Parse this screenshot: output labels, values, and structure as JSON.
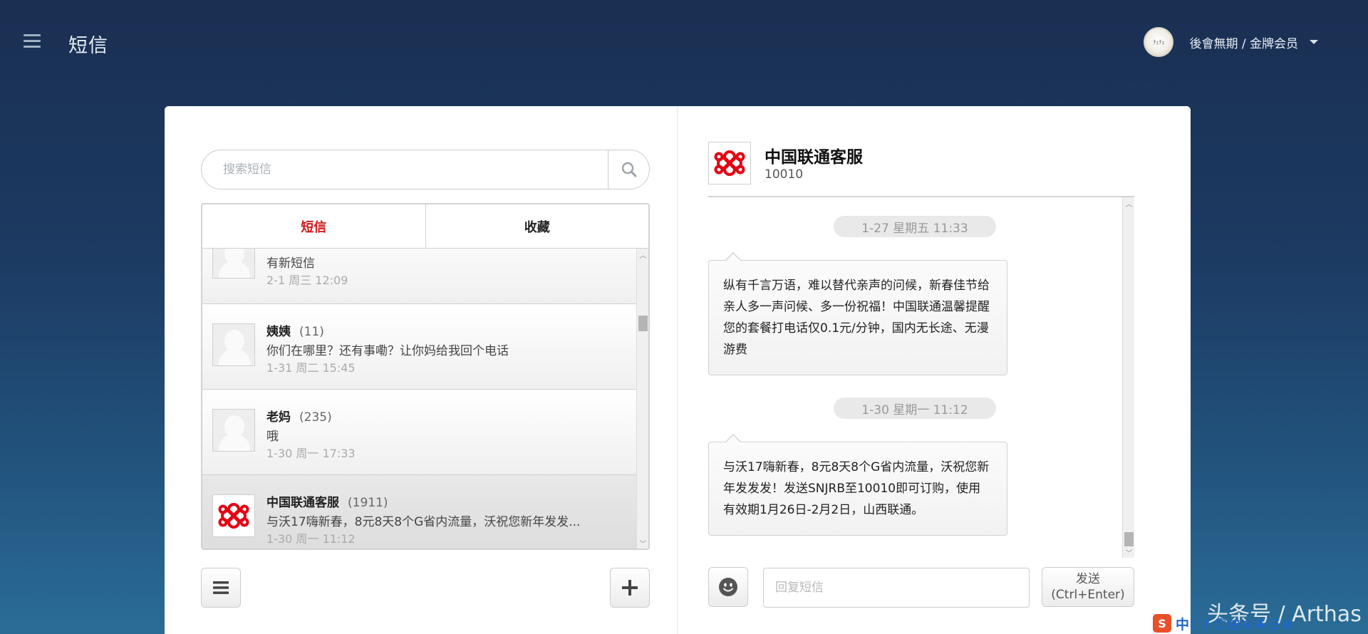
{
  "header": {
    "title": "短信",
    "user_name": "後會無期 / 金牌会员",
    "avatar_text": "ﾁｪﾁｪ"
  },
  "search": {
    "placeholder": "搜索短信"
  },
  "tabs": [
    {
      "label": "短信",
      "active": true
    },
    {
      "label": "收藏",
      "active": false
    }
  ],
  "conversations": [
    {
      "name": "",
      "count": "",
      "message": "有新短信",
      "time": "2-1 周三 12:09",
      "avatar": "ghost-avatar"
    },
    {
      "name": "姨姨",
      "count": "(11)",
      "message": "你们在哪里？还有事嘞？让你妈给我回个电话",
      "time": "1-31 周二 15:45",
      "avatar": "ghost-avatar"
    },
    {
      "name": "老妈",
      "count": "(235)",
      "message": "哦",
      "time": "1-30 周一 17:33",
      "avatar": "ghost-avatar"
    },
    {
      "name": "中国联通客服",
      "count": "(1911)",
      "message": "与沃17嗨新春，8元8天8个G省内流量，沃祝您新年发发...",
      "time": "1-30 周一 11:12",
      "avatar": "unicom-logo"
    }
  ],
  "contact": {
    "name": "中国联通客服",
    "number": "10010"
  },
  "messages": [
    {
      "date": "1-27 星期五 11:33",
      "text": "纵有千言万语，难以替代亲声的问候，新春佳节给亲人多一声问候、多一份祝福！中国联通温馨提醒您的套餐打电话仅0.1元/分钟，国内无长途、无漫游费"
    },
    {
      "date": "1-30 星期一 11:12",
      "text": "与沃17嗨新春，8元8天8个G省内流量，沃祝您新年发发发！发送SNJRB至10010即可订购，使用有效期1月26日-2月2日，山西联通。"
    }
  ],
  "reply": {
    "placeholder": "回复短信",
    "send_label": "发送",
    "send_shortcut": "(Ctrl+Enter)"
  },
  "watermark": "头条号 / Arthas",
  "tray": {
    "logo_letter": "S",
    "icons_text": "中♪↑☺⊞⊕♣☰⊗"
  },
  "colors": {
    "accent_red": "#cc1b1b",
    "unicom_red": "#e60012"
  }
}
